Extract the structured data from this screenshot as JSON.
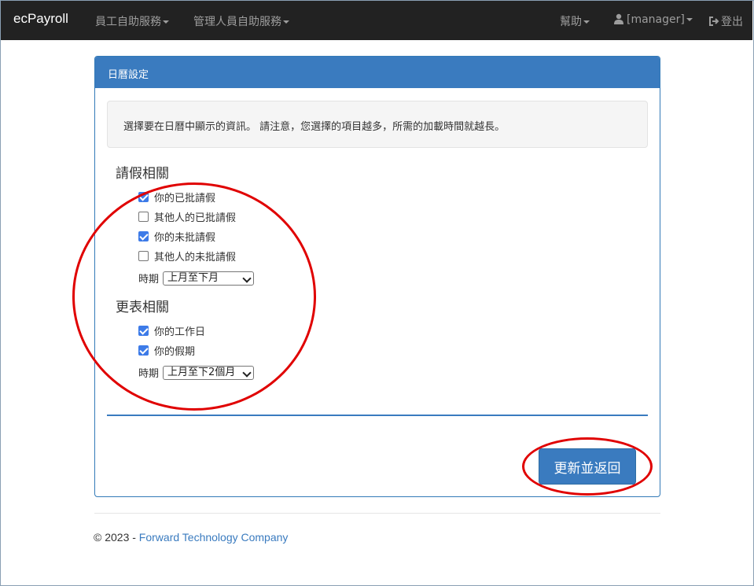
{
  "navbar": {
    "brand": "ecPayroll",
    "menu_employee": "員工自助服務",
    "menu_manager": "管理人員自助服務",
    "help": "幫助",
    "user": "[manager]",
    "logout": "登出"
  },
  "panel": {
    "title": "日曆設定",
    "notice": "選擇要在日曆中顯示的資訊。 請注意，您選擇的項目越多，所需的加載時間就越長。",
    "leave_section": {
      "title": "請假相關",
      "items": [
        {
          "label": "你的已批請假",
          "checked": true
        },
        {
          "label": "其他人的已批請假",
          "checked": false
        },
        {
          "label": "你的未批請假",
          "checked": true
        },
        {
          "label": "其他人的未批請假",
          "checked": false
        }
      ],
      "period_label": "時期",
      "period_value": "上月至下月"
    },
    "shift_section": {
      "title": "更表相關",
      "items": [
        {
          "label": "你的工作日",
          "checked": true
        },
        {
          "label": "你的假期",
          "checked": true
        }
      ],
      "period_label": "時期",
      "period_value": "上月至下2個月"
    },
    "submit_label": "更新並返回"
  },
  "footer": {
    "copyright": "© 2023 - ",
    "company": "Forward Technology Company"
  },
  "colors": {
    "navbar_bg": "#222222",
    "primary": "#3a7bbf",
    "checkbox": "#3d7be8",
    "annotation": "#e00000"
  }
}
